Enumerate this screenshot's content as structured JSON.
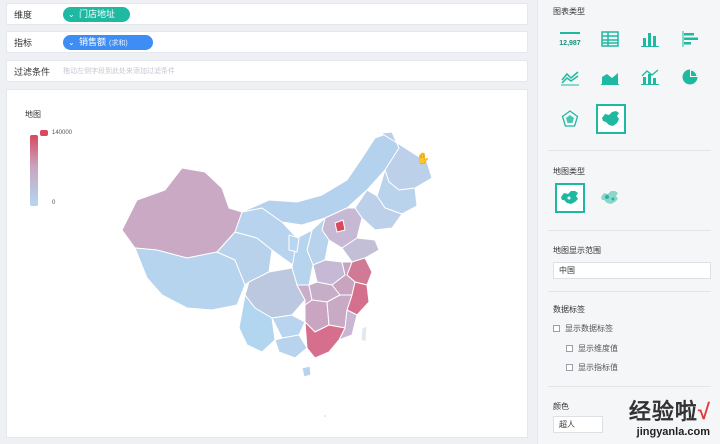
{
  "filters": {
    "dimension": {
      "label": "维度",
      "chip": "门店地址"
    },
    "metric": {
      "label": "指标",
      "chip": "销售额",
      "chip_suffix": "(求和)"
    },
    "filter": {
      "label": "过滤条件",
      "placeholder": "拖动左侧字段到此处来添加过滤条件"
    }
  },
  "canvas": {
    "title": "地图",
    "legend": {
      "max": "140000",
      "min": "0",
      "max_color": "#d8495e",
      "min_color": "#b3d3ee"
    }
  },
  "panel": {
    "chart_type_title": "图表类型",
    "chart_types": [
      {
        "icon": "number-card-icon",
        "text": "12,987",
        "selected": false
      },
      {
        "icon": "table-icon",
        "selected": false
      },
      {
        "icon": "column-chart-icon",
        "selected": false
      },
      {
        "icon": "bar-chart-icon",
        "selected": false
      },
      {
        "icon": "line-chart-icon",
        "selected": false
      },
      {
        "icon": "area-chart-icon",
        "selected": false
      },
      {
        "icon": "combo-chart-icon",
        "selected": false
      },
      {
        "icon": "pie-chart-icon",
        "selected": false
      },
      {
        "icon": "radar-chart-icon",
        "selected": false
      },
      {
        "icon": "map-chart-icon",
        "selected": true
      }
    ],
    "map_type_title": "地图类型",
    "map_types": [
      {
        "icon": "filled-map-icon",
        "selected": true
      },
      {
        "icon": "bubble-map-icon",
        "selected": false
      }
    ],
    "map_range_title": "地图显示范围",
    "map_range_value": "中国",
    "data_label_title": "数据标签",
    "show_data_label": "显示数据标签",
    "show_dimension": "显示维度值",
    "show_metric": "显示指标值",
    "color_title": "颜色",
    "color_value": "超人"
  },
  "watermark": {
    "text": "经验啦",
    "check": "√",
    "url": "jingyanla.com"
  }
}
